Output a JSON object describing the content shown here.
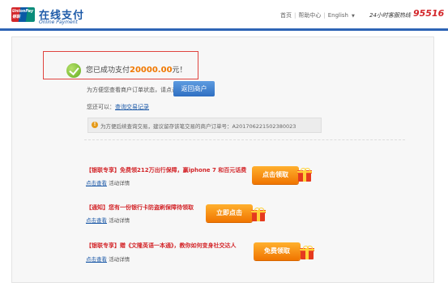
{
  "header": {
    "logo_text_line1": "UnionPay",
    "logo_text_line2": "银联",
    "brand_cn": "在线支付",
    "brand_en": "Online Payment",
    "nav": {
      "home": "首页",
      "help": "帮助中心",
      "language": "English"
    },
    "hotline_label": "24小时客服热线",
    "hotline_number": "95516"
  },
  "success": {
    "prefix": "您已成功支付",
    "amount": "20000.00",
    "suffix": "元！"
  },
  "order_status": {
    "text": "为方便您查看商户订单状态，请点击",
    "button": "返回商户"
  },
  "records": {
    "label": "您还可以：",
    "link": "查询交易记录"
  },
  "notice": {
    "text": "为方便后续查询交易，建议留存该笔交易的商户订单号：A201706221502380023"
  },
  "promos": [
    {
      "title": "【银联专享】免费领212万出行保障，赢iphone 7 和百元话费",
      "detail_link": "点击查看",
      "detail_suffix": "活动详情",
      "button": "点击领取"
    },
    {
      "title": "【通知】您有一份银行卡防盗刷保障待领取",
      "detail_link": "点击查看",
      "detail_suffix": "活动详情",
      "button": "立即点击"
    },
    {
      "title": "【银联专享】赠《文隆英语一本通》，教你如何变身社交达人",
      "detail_link": "点击查看",
      "detail_suffix": "活动详情",
      "button": "免费领取"
    }
  ],
  "colors": {
    "brand_blue": "#1d5aa8",
    "accent_red": "#d3262a",
    "amount_orange": "#f07800",
    "button_blue": "#2f6fc2",
    "promo_orange": "#f07500"
  }
}
